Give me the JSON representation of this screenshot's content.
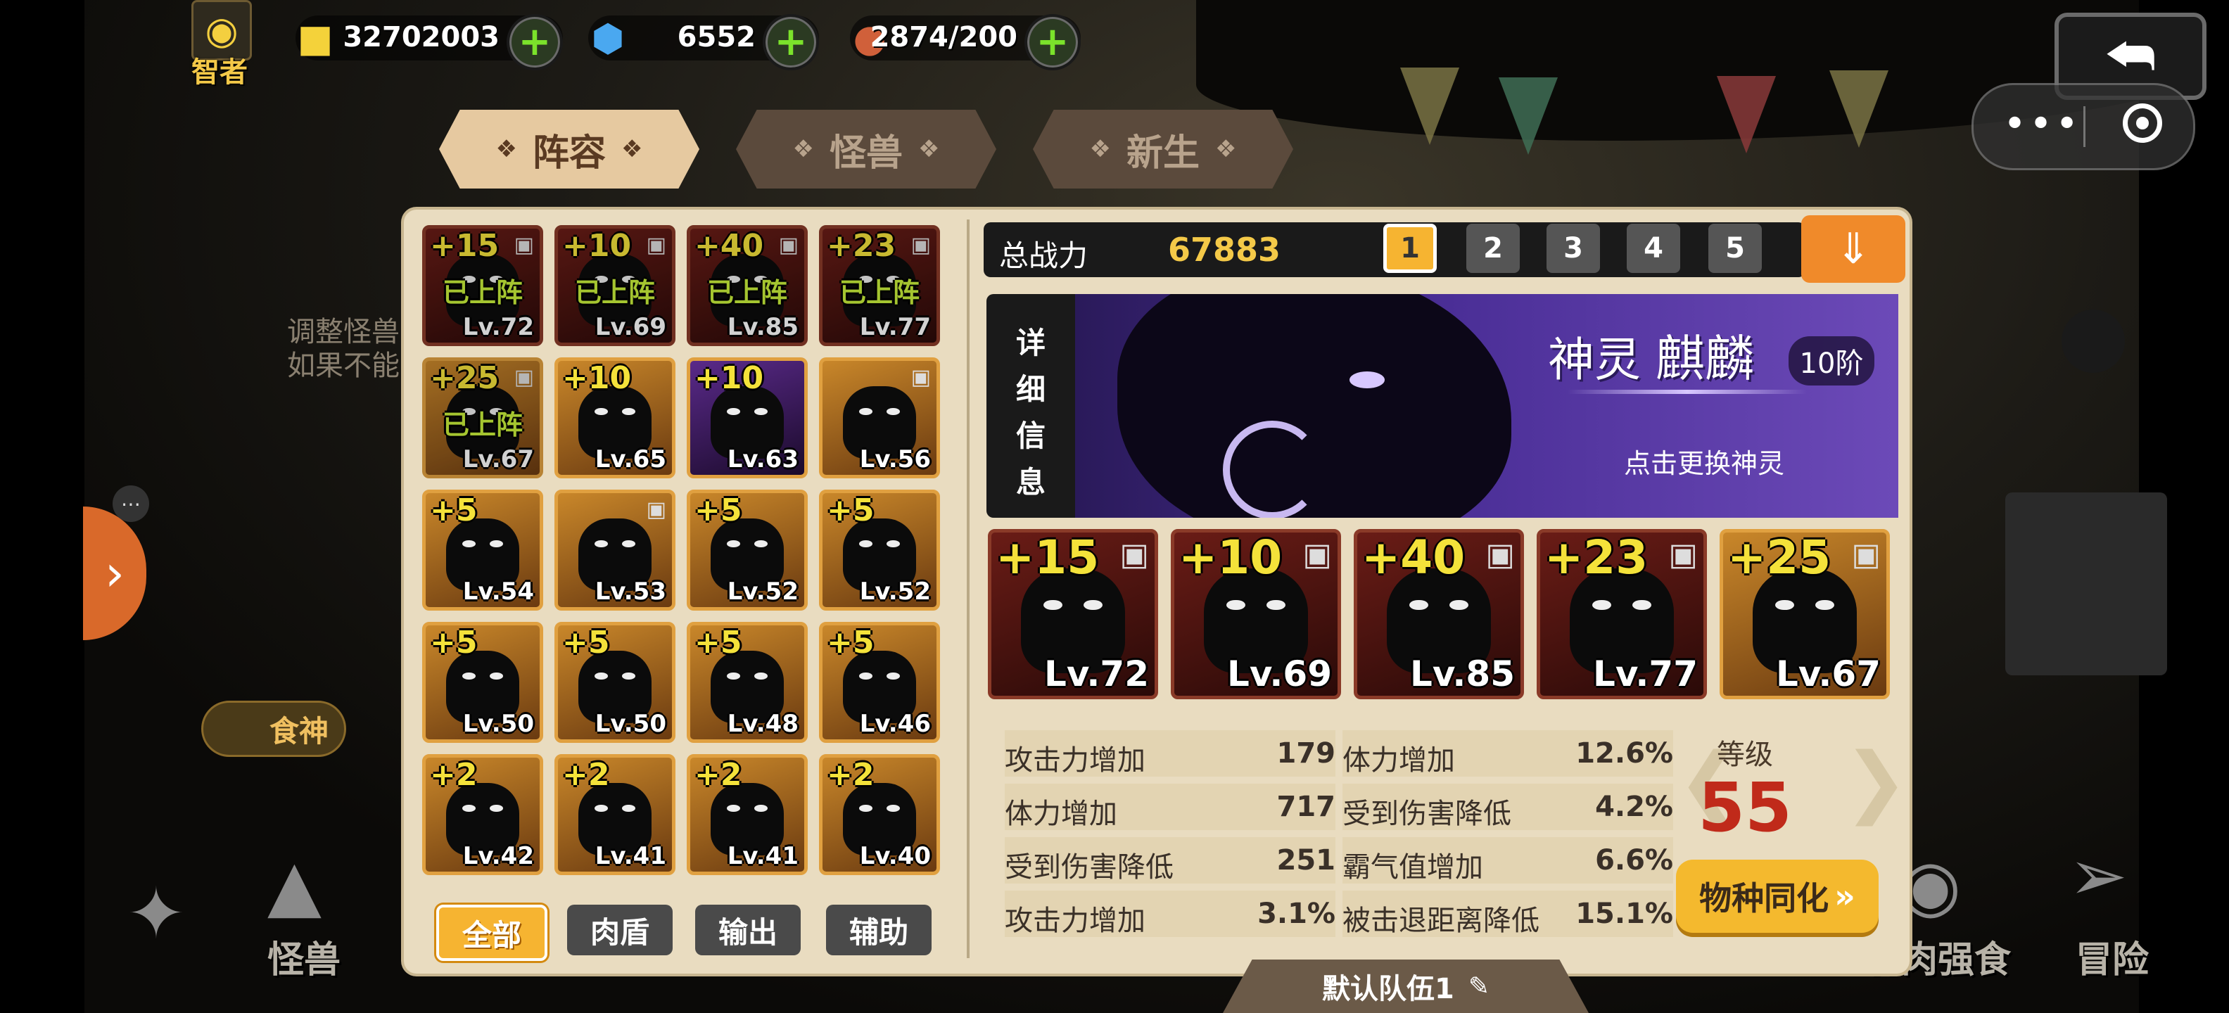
{
  "topbar": {
    "title_badge": "智者",
    "resources": [
      {
        "icon": "gold-coin-icon",
        "value": "32702003"
      },
      {
        "icon": "blue-gem-icon",
        "value": "6552"
      },
      {
        "icon": "meat-drumstick-icon",
        "value": "2874/200"
      }
    ],
    "plus_label": "+"
  },
  "tabs": [
    {
      "label": "阵容",
      "active": true
    },
    {
      "label": "怪兽",
      "active": false
    },
    {
      "label": "新生",
      "active": false
    }
  ],
  "background": {
    "hint_line1": "调整怪兽",
    "hint_line2": "如果不能",
    "food_god": "食神",
    "nav": [
      "怪兽",
      "弱肉强食",
      "冒险"
    ]
  },
  "roster": [
    {
      "plus": "+15",
      "level": "Lv.72",
      "locked": true,
      "deployed": true,
      "frame": "red"
    },
    {
      "plus": "+10",
      "level": "Lv.69",
      "locked": true,
      "deployed": true,
      "frame": "red"
    },
    {
      "plus": "+40",
      "level": "Lv.85",
      "locked": true,
      "deployed": true,
      "frame": "red"
    },
    {
      "plus": "+23",
      "level": "Lv.77",
      "locked": true,
      "deployed": true,
      "frame": "red"
    },
    {
      "plus": "+25",
      "level": "Lv.67",
      "locked": true,
      "deployed": true,
      "frame": "gold"
    },
    {
      "plus": "+10",
      "level": "Lv.65",
      "locked": false,
      "deployed": false,
      "frame": "gold"
    },
    {
      "plus": "+10",
      "level": "Lv.63",
      "locked": false,
      "deployed": false,
      "frame": "purple"
    },
    {
      "plus": "",
      "level": "Lv.56",
      "locked": true,
      "deployed": false,
      "frame": "gold"
    },
    {
      "plus": "+5",
      "level": "Lv.54",
      "locked": false,
      "deployed": false,
      "frame": "gold"
    },
    {
      "plus": "",
      "level": "Lv.53",
      "locked": true,
      "deployed": false,
      "frame": "gold"
    },
    {
      "plus": "+5",
      "level": "Lv.52",
      "locked": false,
      "deployed": false,
      "frame": "gold"
    },
    {
      "plus": "+5",
      "level": "Lv.52",
      "locked": false,
      "deployed": false,
      "frame": "gold"
    },
    {
      "plus": "+5",
      "level": "Lv.50",
      "locked": false,
      "deployed": false,
      "frame": "gold"
    },
    {
      "plus": "+5",
      "level": "Lv.50",
      "locked": false,
      "deployed": false,
      "frame": "gold"
    },
    {
      "plus": "+5",
      "level": "Lv.48",
      "locked": false,
      "deployed": false,
      "frame": "gold"
    },
    {
      "plus": "+5",
      "level": "Lv.46",
      "locked": false,
      "deployed": false,
      "frame": "gold"
    },
    {
      "plus": "+2",
      "level": "Lv.42",
      "locked": false,
      "deployed": false,
      "frame": "gold"
    },
    {
      "plus": "+2",
      "level": "Lv.41",
      "locked": false,
      "deployed": false,
      "frame": "gold"
    },
    {
      "plus": "+2",
      "level": "Lv.41",
      "locked": false,
      "deployed": false,
      "frame": "gold"
    },
    {
      "plus": "+2",
      "level": "Lv.40",
      "locked": false,
      "deployed": false,
      "frame": "gold"
    }
  ],
  "deployed_label": "已上阵",
  "filters": [
    {
      "label": "全部",
      "active": true
    },
    {
      "label": "肉盾",
      "active": false
    },
    {
      "label": "输出",
      "active": false
    },
    {
      "label": "辅助",
      "active": false
    }
  ],
  "power": {
    "label": "总战力",
    "value": "67883"
  },
  "teams": [
    "1",
    "2",
    "3",
    "4",
    "5"
  ],
  "active_team": "1",
  "detail_tab": [
    "详",
    "细",
    "信",
    "息"
  ],
  "deity": {
    "prefix": "神灵",
    "name": "麒麟",
    "rank": "10阶",
    "change_label": "点击更换神灵"
  },
  "lineup": [
    {
      "plus": "+15",
      "level": "Lv.72",
      "frame": "red"
    },
    {
      "plus": "+10",
      "level": "Lv.69",
      "frame": "red"
    },
    {
      "plus": "+40",
      "level": "Lv.85",
      "frame": "red"
    },
    {
      "plus": "+23",
      "level": "Lv.77",
      "frame": "red"
    },
    {
      "plus": "+25",
      "level": "Lv.67",
      "frame": "gold"
    }
  ],
  "stats_left": [
    {
      "k": "攻击力增加",
      "v": "179"
    },
    {
      "k": "体力增加",
      "v": "717"
    },
    {
      "k": "受到伤害降低",
      "v": "251"
    },
    {
      "k": "攻击力增加",
      "v": "3.1%"
    }
  ],
  "stats_right": [
    {
      "k": "体力增加",
      "v": "12.6%"
    },
    {
      "k": "受到伤害降低",
      "v": "4.2%"
    },
    {
      "k": "霸气值增加",
      "v": "6.6%"
    },
    {
      "k": "被击退距离降低",
      "v": "15.1%"
    }
  ],
  "level": {
    "title": "等级",
    "value": "55"
  },
  "sync_button": "物种同化",
  "team_name": "默认队伍1",
  "colors": {
    "accent": "#f6b431",
    "deployed_text": "#c9f03a",
    "plus_text": "#f4e23a",
    "level_red": "#c02a1a",
    "banner_purple": "#4a2e96"
  }
}
